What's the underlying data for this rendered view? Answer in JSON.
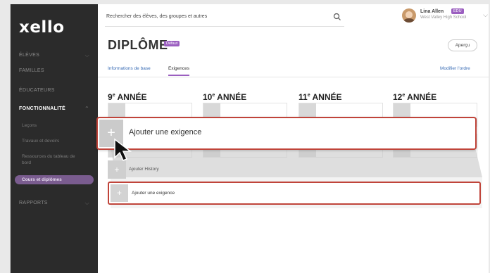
{
  "sidebar": {
    "logo": "xello",
    "items": [
      {
        "label": "ÉLÈVES"
      },
      {
        "label": "FAMILLES"
      },
      {
        "label": "ÉDUCATEURS"
      },
      {
        "label": "FONCTIONNALITÉ"
      },
      {
        "label": "RAPPORTS"
      }
    ],
    "sub_items": [
      {
        "label": "Leçons"
      },
      {
        "label": "Travaux et devoirs"
      },
      {
        "label": "Ressources du tableau de"
      },
      {
        "label": "bord"
      },
      {
        "label": "Cours et diplômes"
      }
    ]
  },
  "search": {
    "placeholder": "Rechercher des élèves, des groupes et autres"
  },
  "user": {
    "name": "Lina Allen",
    "badge": "EDU",
    "school": "West Valley High School"
  },
  "header": {
    "title": "DIPLÔME",
    "badge": "Défaut",
    "preview": "Aperçu"
  },
  "tabs": [
    {
      "label": "Informations de base"
    },
    {
      "label": "Exigences"
    }
  ],
  "reorder": "Modifier l'ordre",
  "years": [
    {
      "num": "9",
      "sup": "e",
      "label": " ANNÉE"
    },
    {
      "num": "10",
      "sup": "e",
      "label": " ANNÉE"
    },
    {
      "num": "11",
      "sup": "e",
      "label": " ANNÉE"
    },
    {
      "num": "12",
      "sup": "e",
      "label": " ANNÉE"
    }
  ],
  "rows": {
    "add_history": "Ajouter History",
    "add_requirement": "Ajouter une exigence"
  },
  "zoom": {
    "label": "Ajouter une exigence"
  },
  "colors": {
    "accent": "#9b5fc0",
    "highlight": "#c0443a",
    "sidebar": "#2b2b2b"
  }
}
